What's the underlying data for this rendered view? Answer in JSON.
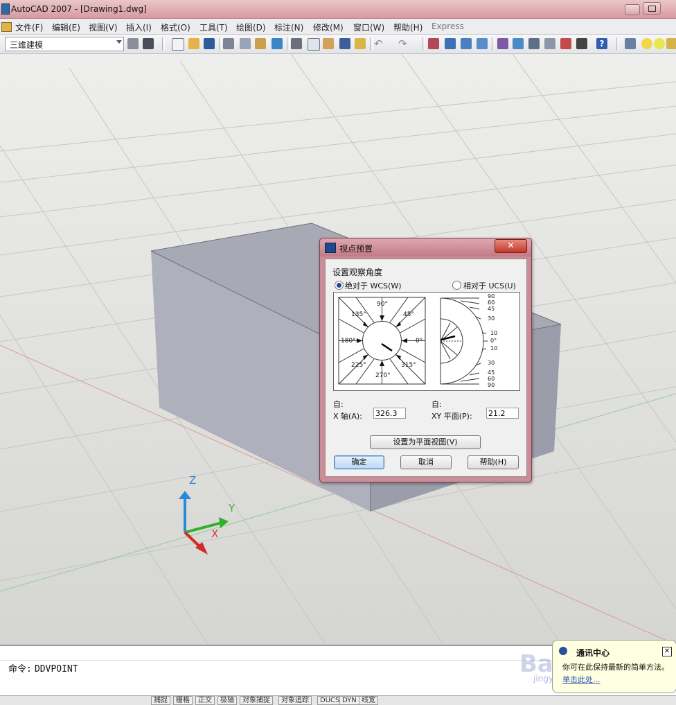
{
  "window": {
    "title": "AutoCAD 2007 - [Drawing1.dwg]"
  },
  "menu": [
    "文件(F)",
    "编辑(E)",
    "视图(V)",
    "插入(I)",
    "格式(O)",
    "工具(T)",
    "绘图(D)",
    "标注(N)",
    "修改(M)",
    "窗口(W)",
    "帮助(H)",
    "Express"
  ],
  "toolbar": {
    "workspace": "三维建模"
  },
  "ucs": {
    "z": "Z",
    "y": "Y",
    "x": "X"
  },
  "dialog": {
    "title": "视点预置",
    "close": "✕",
    "section": "设置观察角度",
    "radio_wcs": "绝对于 WCS(W)",
    "radio_ucs": "相对于 UCS(U)",
    "compass_labels": [
      "90°",
      "45°",
      "0°",
      "315°",
      "270°",
      "225°",
      "180°",
      "135°"
    ],
    "elevation_labels": [
      "90",
      "60",
      "45",
      "30",
      "10",
      "0°",
      "10",
      "30",
      "45",
      "60",
      "90"
    ],
    "from_x_label1": "自:",
    "from_x_label2": "X 轴(A):",
    "x_value": "326.3",
    "from_xy_label1": "自:",
    "from_xy_label2": "XY 平面(P):",
    "xy_value": "21.2",
    "plan_button": "设置为平面视图(V)",
    "ok": "确定",
    "cancel": "取消",
    "help": "帮助(H)"
  },
  "command": {
    "prompt": "命令:",
    "value": "DDVPOINT"
  },
  "statusbar": [
    "捕捉",
    "栅格",
    "正交",
    "极轴",
    "对象捕捉",
    "对象追踪",
    "DUCS",
    "DYN",
    "线宽"
  ],
  "balloon": {
    "title": "通讯中心",
    "text": "你可在此保持最新的简单方法。",
    "link": "单击此处..."
  },
  "watermark": {
    "brand": "Baidu经验",
    "site": "jingyan.baidu.com"
  }
}
